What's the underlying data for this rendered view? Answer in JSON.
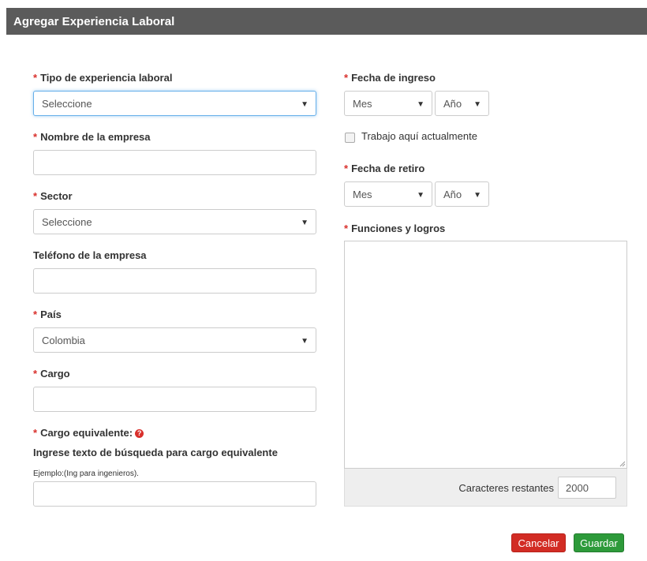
{
  "header": {
    "title": "Agregar Experiencia Laboral"
  },
  "required_mark": "*",
  "left": {
    "tipo": {
      "label": "Tipo de experiencia laboral",
      "value": "Seleccione"
    },
    "empresa": {
      "label": "Nombre de la empresa",
      "value": ""
    },
    "sector": {
      "label": "Sector",
      "value": "Seleccione"
    },
    "telefono": {
      "label": "Teléfono de la empresa",
      "value": ""
    },
    "pais": {
      "label": "País",
      "value": "Colombia"
    },
    "cargo": {
      "label": "Cargo",
      "value": ""
    },
    "cargo_equivalente": {
      "label": "Cargo equivalente:",
      "help_icon": "?",
      "instruction": "Ingrese texto de búsqueda para cargo equivalente",
      "example": "Ejemplo:(Ing para ingenieros).",
      "value": ""
    }
  },
  "right": {
    "fecha_ingreso": {
      "label": "Fecha de ingreso",
      "mes": "Mes",
      "anio": "Año"
    },
    "trabajo_actual": {
      "label": "Trabajo aquí actualmente",
      "checked": false
    },
    "fecha_retiro": {
      "label": "Fecha de retiro",
      "mes": "Mes",
      "anio": "Año"
    },
    "funciones": {
      "label": "Funciones y logros",
      "value": "",
      "counter_label": "Caracteres restantes",
      "counter_value": "2000"
    }
  },
  "actions": {
    "cancel": "Cancelar",
    "save": "Guardar"
  },
  "colors": {
    "header_bg": "#5b5b5b",
    "required": "#d9302c",
    "cancel_bg": "#d22c24",
    "save_bg": "#2d9a3a",
    "focus": "#66afe9"
  },
  "icons": {
    "caret": "caret-down-icon",
    "help": "help-circle-icon",
    "resize": "resize-grip-icon"
  }
}
